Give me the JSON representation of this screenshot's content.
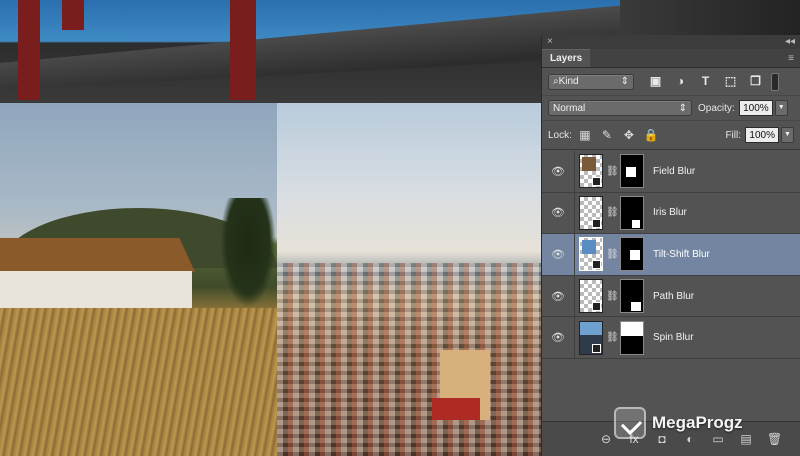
{
  "panel": {
    "close_glyph": "×",
    "collapse_glyph": "◂◂",
    "tab_label": "Layers",
    "menu_glyph": "≡",
    "filter": {
      "kind_label": "⌕Kind",
      "icons": [
        "image-filter-icon",
        "adjustment-filter-icon",
        "type-filter-icon",
        "shape-filter-icon",
        "smart-object-filter-icon"
      ],
      "icon_glyphs": [
        "▣",
        "◑",
        "T",
        "⬚",
        "❐"
      ]
    },
    "blend_mode": "Normal",
    "opacity_label": "Opacity:",
    "opacity_value": "100%",
    "lock_label": "Lock:",
    "lock_icons": [
      "lock-transparent-icon",
      "lock-paint-icon",
      "lock-position-icon",
      "lock-all-icon"
    ],
    "lock_glyphs": [
      "▦",
      "✎",
      "✥",
      "🔒"
    ],
    "fill_label": "Fill:",
    "fill_value": "100%",
    "layers": [
      {
        "name": "Field Blur",
        "selected": false
      },
      {
        "name": "Iris Blur",
        "selected": false
      },
      {
        "name": "Tilt-Shift Blur",
        "selected": true
      },
      {
        "name": "Path Blur",
        "selected": false
      },
      {
        "name": "Spin Blur",
        "selected": false
      }
    ],
    "bottom_icons": [
      "link-layers-icon",
      "fx-icon",
      "add-mask-icon",
      "adjustment-layer-icon",
      "group-icon",
      "new-layer-icon",
      "trash-icon"
    ],
    "bottom_glyphs": [
      "⊖",
      "fx",
      "◘",
      "◐",
      "▭",
      "▤",
      "🗑"
    ]
  },
  "watermark": {
    "text": "MegaProgz"
  },
  "colors": {
    "panel_bg": "#535353",
    "selected_layer": "#7385a0"
  }
}
